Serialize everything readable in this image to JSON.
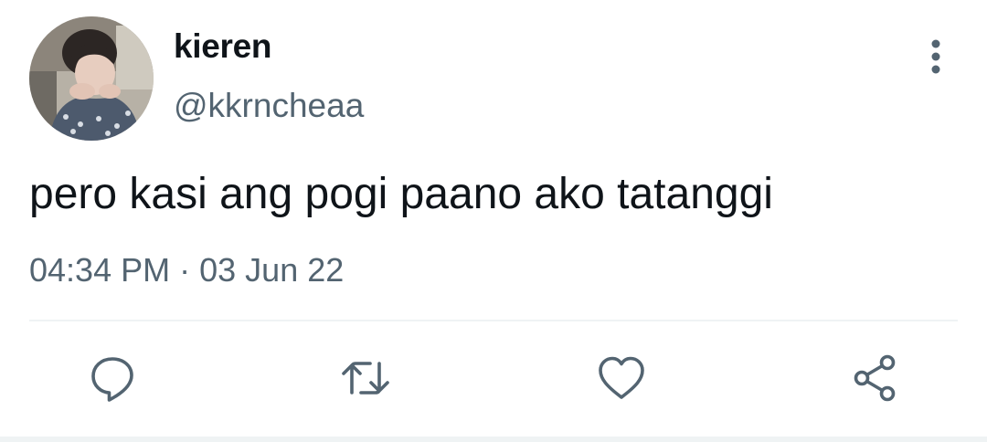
{
  "tweet": {
    "display_name": "kieren",
    "handle": "@kkrncheaa",
    "text": "pero kasi ang pogi paano ako tatanggi",
    "time": "04:34 PM",
    "separator": "·",
    "date": "03 Jun 22"
  },
  "icons": {
    "avatar": "profile-photo",
    "more": "vertical-ellipsis-icon",
    "reply": "reply-bubble-icon",
    "retweet": "retweet-icon",
    "like": "heart-icon",
    "share": "share-icon"
  },
  "colors": {
    "text_primary": "#0f1419",
    "text_secondary": "#536471",
    "icon": "#536471",
    "divider": "#eff3f4",
    "background": "#ffffff"
  }
}
